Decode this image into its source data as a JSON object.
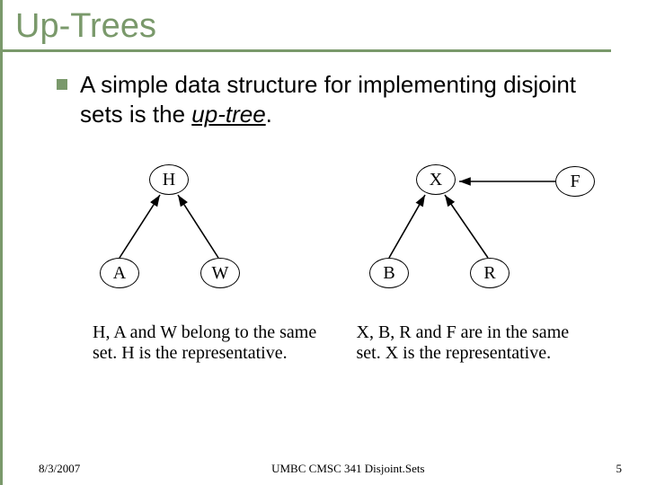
{
  "title": "Up-Trees",
  "bullet": {
    "pre": "A simple data structure for implementing disjoint sets is the ",
    "em": "up-tree",
    "post": "."
  },
  "nodes": {
    "H": "H",
    "A": "A",
    "W": "W",
    "X": "X",
    "B": "B",
    "R": "R",
    "F": "F"
  },
  "captions": {
    "left": "H, A and W belong to the same set. H is the representative.",
    "right": "X, B, R and F are in the same set. X is the representative."
  },
  "footer": {
    "date": "8/3/2007",
    "course": "UMBC CMSC 341 Disjoint.Sets",
    "page": "5"
  }
}
